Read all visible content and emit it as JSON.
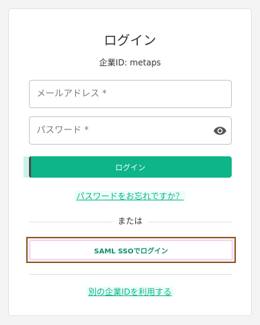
{
  "login": {
    "title": "ログイン",
    "company_line": "企業ID: metaps",
    "email_placeholder": "メールアドレス *",
    "password_placeholder": "パスワード *",
    "password_toggle_icon": "eye-icon",
    "login_button_label": "ログイン",
    "forgot_password_link": "パスワードをお忘れですか？",
    "divider_text": "または",
    "saml_button_label": "SAML SSOでログイン",
    "other_company_link": "別の企業IDを利用する"
  },
  "colors": {
    "accent": "#0db589",
    "saml_outline": "#8b5a1c"
  }
}
